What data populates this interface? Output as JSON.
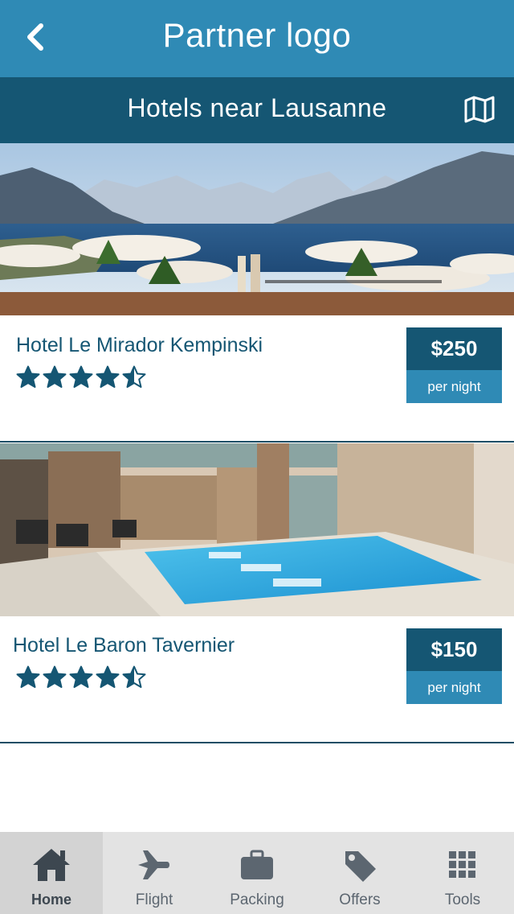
{
  "header": {
    "title": "Partner logo",
    "back_icon": "chevron-left-icon"
  },
  "subheader": {
    "title": "Hotels near Lausanne",
    "map_icon": "map-icon"
  },
  "hotels": [
    {
      "name": "Hotel Le Mirador Kempinski",
      "rating": 4.5,
      "rating_max": 5,
      "price": "$250",
      "price_unit": "per night"
    },
    {
      "name": "Hotel Le Baron Tavernier",
      "rating": 4.5,
      "rating_max": 5,
      "price": "$150",
      "price_unit": "per night"
    }
  ],
  "tabs": [
    {
      "label": "Home",
      "icon": "home-icon",
      "active": true
    },
    {
      "label": "Flight",
      "icon": "airplane-icon",
      "active": false
    },
    {
      "label": "Packing",
      "icon": "briefcase-icon",
      "active": false
    },
    {
      "label": "Offers",
      "icon": "tag-icon",
      "active": false
    },
    {
      "label": "Tools",
      "icon": "grid-icon",
      "active": false
    }
  ],
  "colors": {
    "header_bg": "#2f8ab5",
    "subheader_bg": "#155673",
    "price_bg": "#155673",
    "price_unit_bg": "#2f8ab5",
    "star": "#155673",
    "tabbar_bg": "#e3e3e3"
  }
}
